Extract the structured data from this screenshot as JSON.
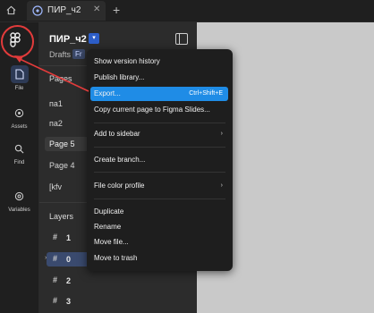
{
  "tabbar": {
    "tab_label": "ПИР_ч2",
    "new_tab_symbol": "+",
    "icons": [
      "home-icon",
      "figma-file-icon",
      "close-icon"
    ]
  },
  "rail": {
    "items": [
      {
        "label": "File",
        "icon": "file-icon"
      },
      {
        "label": "Assets",
        "icon": "assets-icon"
      },
      {
        "label": "Find",
        "icon": "search-icon"
      },
      {
        "label": "Variables",
        "icon": "variables-icon"
      }
    ],
    "annotation_color": "#e23b3b"
  },
  "panel": {
    "file_title": "ПИР_ч2",
    "location": "Drafts",
    "badge": "Fr",
    "pages_heading": "Pages",
    "pages": [
      "па1",
      "па2",
      "Page 5",
      "Page 4",
      "[kfv"
    ],
    "layers_heading": "Layers",
    "layers": [
      "1",
      "0",
      "2",
      "3"
    ]
  },
  "menu": {
    "items": [
      {
        "label": "Show version history"
      },
      {
        "label": "Publish library..."
      },
      {
        "label": "Export...",
        "shortcut": "Ctrl+Shift+E"
      },
      {
        "label": "Copy current page to Figma Slides..."
      },
      {
        "label": "Add to sidebar"
      },
      {
        "label": "Create branch..."
      },
      {
        "label": "File color profile"
      },
      {
        "label": "Duplicate"
      },
      {
        "label": "Rename"
      },
      {
        "label": "Move file..."
      },
      {
        "label": "Move to trash"
      }
    ],
    "highlight_color": "#1f8ce6",
    "submenu_symbol": "›"
  }
}
